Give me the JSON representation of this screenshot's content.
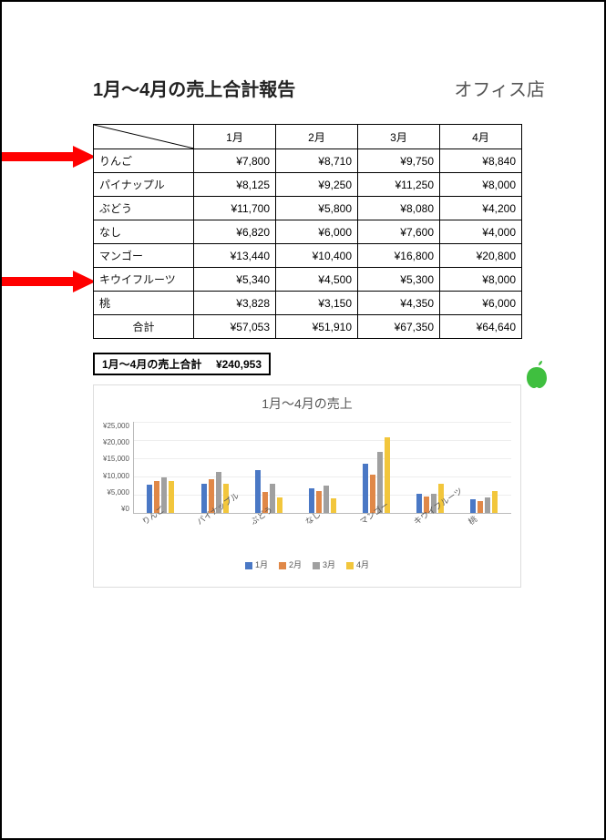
{
  "title": "1月～4月の売上合計報告",
  "store": "オフィス店",
  "months": [
    "1月",
    "2月",
    "3月",
    "4月"
  ],
  "rows": [
    {
      "label": "りんご",
      "values": [
        "¥7,800",
        "¥8,710",
        "¥9,750",
        "¥8,840"
      ]
    },
    {
      "label": "パイナップル",
      "values": [
        "¥8,125",
        "¥9,250",
        "¥11,250",
        "¥8,000"
      ]
    },
    {
      "label": "ぶどう",
      "values": [
        "¥11,700",
        "¥5,800",
        "¥8,080",
        "¥4,200"
      ]
    },
    {
      "label": "なし",
      "values": [
        "¥6,820",
        "¥6,000",
        "¥7,600",
        "¥4,000"
      ]
    },
    {
      "label": "マンゴー",
      "values": [
        "¥13,440",
        "¥10,400",
        "¥16,800",
        "¥20,800"
      ]
    },
    {
      "label": "キウイフルーツ",
      "values": [
        "¥5,340",
        "¥4,500",
        "¥5,300",
        "¥8,000"
      ]
    },
    {
      "label": "桃",
      "values": [
        "¥3,828",
        "¥3,150",
        "¥4,350",
        "¥6,000"
      ]
    }
  ],
  "totals": {
    "label": "合計",
    "values": [
      "¥57,053",
      "¥51,910",
      "¥67,350",
      "¥64,640"
    ]
  },
  "summary": {
    "label": "1月～4月の売上合計",
    "value": "¥240,953"
  },
  "chart_data": {
    "type": "bar",
    "title": "1月～4月の売上",
    "categories": [
      "りんご",
      "パイナップル",
      "ぶどう",
      "なし",
      "マンゴー",
      "キウイフルーツ",
      "桃"
    ],
    "series": [
      {
        "name": "1月",
        "values": [
          7800,
          8125,
          11700,
          6820,
          13440,
          5340,
          3828
        ]
      },
      {
        "name": "2月",
        "values": [
          8710,
          9250,
          5800,
          6000,
          10400,
          4500,
          3150
        ]
      },
      {
        "name": "3月",
        "values": [
          9750,
          11250,
          8080,
          7600,
          16800,
          5300,
          4350
        ]
      },
      {
        "name": "4月",
        "values": [
          8840,
          8000,
          4200,
          4000,
          20800,
          8000,
          6000
        ]
      }
    ],
    "ylim": [
      0,
      25000
    ],
    "yticks": [
      "¥25,000",
      "¥20,000",
      "¥15,000",
      "¥10,000",
      "¥5,000",
      "¥0"
    ],
    "legend_entries": [
      "1月",
      "2月",
      "3月",
      "4月"
    ]
  },
  "annotations": {
    "highlighted_rows": [
      "りんご",
      "キウイフルーツ"
    ]
  }
}
